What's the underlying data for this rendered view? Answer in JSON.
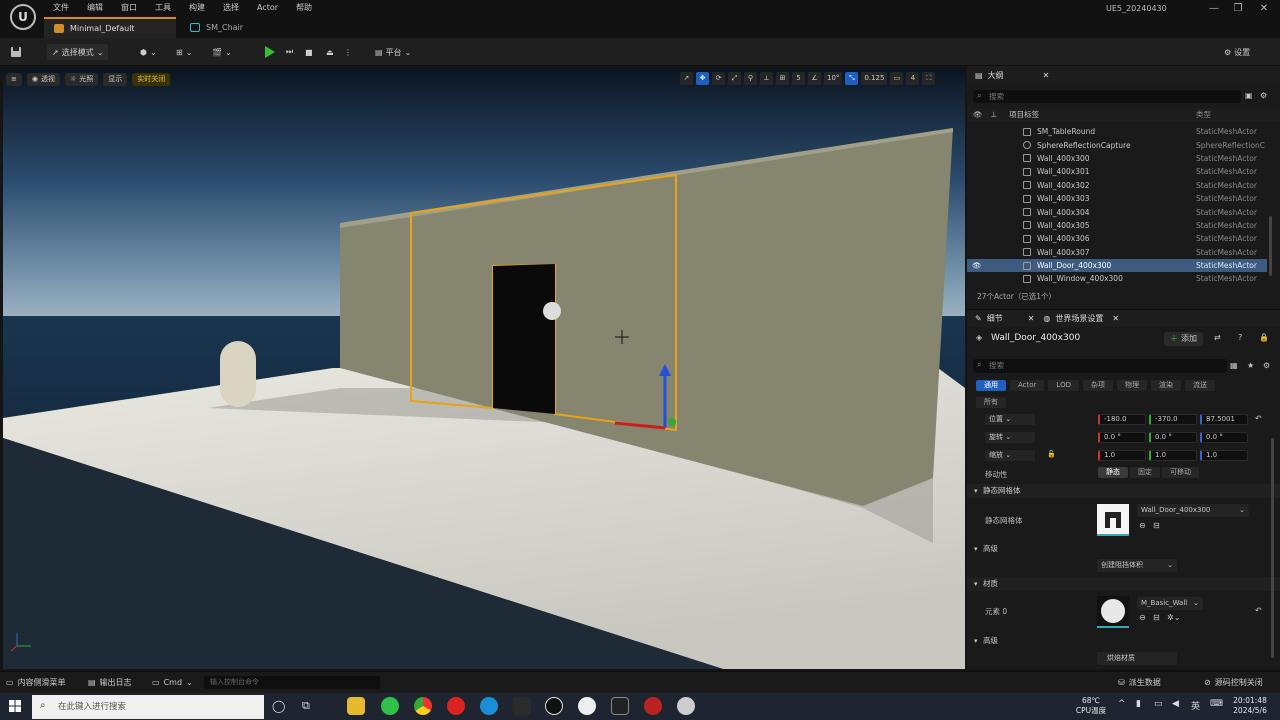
{
  "menu": [
    "文件",
    "编辑",
    "窗口",
    "工具",
    "构建",
    "选择",
    "Actor",
    "帮助"
  ],
  "tabs": {
    "main": "Minimal_Default",
    "second": "SM_Chair"
  },
  "project_name": "UE5_20240430",
  "toolbar": {
    "mode": "选择模式",
    "platform": "平台",
    "settings": "设置"
  },
  "viewport": {
    "buttons": {
      "perspective": "透视",
      "lit": "光照",
      "show": "显示",
      "realtime_off": "实时关闭"
    },
    "grid_snap": "5",
    "rot_snap": "10°",
    "scale_snap": "0.125",
    "cam_speed": "4"
  },
  "outliner": {
    "title": "大纲",
    "search_placeholder": "搜索",
    "col_label": "项目标签",
    "col_type": "类型",
    "rows": [
      {
        "name": "SM_TableRound",
        "type": "StaticMeshActor"
      },
      {
        "name": "SphereReflectionCapture",
        "type": "SphereReflectionC"
      },
      {
        "name": "Wall_400x300",
        "type": "StaticMeshActor"
      },
      {
        "name": "Wall_400x301",
        "type": "StaticMeshActor"
      },
      {
        "name": "Wall_400x302",
        "type": "StaticMeshActor"
      },
      {
        "name": "Wall_400x303",
        "type": "StaticMeshActor"
      },
      {
        "name": "Wall_400x304",
        "type": "StaticMeshActor"
      },
      {
        "name": "Wall_400x305",
        "type": "StaticMeshActor"
      },
      {
        "name": "Wall_400x306",
        "type": "StaticMeshActor"
      },
      {
        "name": "Wall_400x307",
        "type": "StaticMeshActor"
      },
      {
        "name": "Wall_Door_400x300",
        "type": "StaticMeshActor"
      },
      {
        "name": "Wall_Window_400x300",
        "type": "StaticMeshActor"
      }
    ],
    "count": "27个Actor（已选1个）"
  },
  "details": {
    "tab_details": "细节",
    "tab_world": "世界场景设置",
    "actor_name": "Wall_Door_400x300",
    "add": "添加",
    "search_placeholder": "搜索",
    "subtabs": [
      "通用",
      "Actor",
      "LOD",
      "杂项",
      "物理",
      "渲染",
      "流送"
    ],
    "all": "所有",
    "location_label": "位置",
    "rotation_label": "旋转",
    "scale_label": "缩放",
    "location": [
      "-180.0",
      "-370.0",
      "87.5001"
    ],
    "rotation": [
      "0.0 °",
      "0.0 °",
      "0.0 °"
    ],
    "scale": [
      "1.0",
      "1.0",
      "1.0"
    ],
    "mobility_label": "移动性",
    "mobility": [
      "静态",
      "固定",
      "可移动"
    ],
    "cat_static_mesh": "静态网格体",
    "static_mesh_label": "静态网格体",
    "static_mesh_value": "Wall_Door_400x300",
    "cat_advanced": "高级",
    "create_collision": "创建阻挡体积",
    "cat_materials": "材质",
    "element0": "元素 0",
    "material_value": "M_Basic_Wall",
    "cat_advanced2": "高级",
    "bake_material": "烘焙材质"
  },
  "statusbar": {
    "content_drawer": "内容侧滑菜单",
    "output_log": "输出日志",
    "cmd": "Cmd",
    "console_placeholder": "输入控制台命令",
    "derived_data": "派生数据",
    "source_control": "源码控制关闭"
  },
  "taskbar": {
    "search_placeholder": "在此键入进行搜索",
    "temp": "68℃",
    "cpu": "CPU温度",
    "ime": "英",
    "time": "20:01:48",
    "date": "2024/5/6"
  },
  "colors": {
    "accent": "#1f5fbf",
    "selection": "#3d5a80",
    "play": "#33c033",
    "outline": "#e8a317"
  }
}
